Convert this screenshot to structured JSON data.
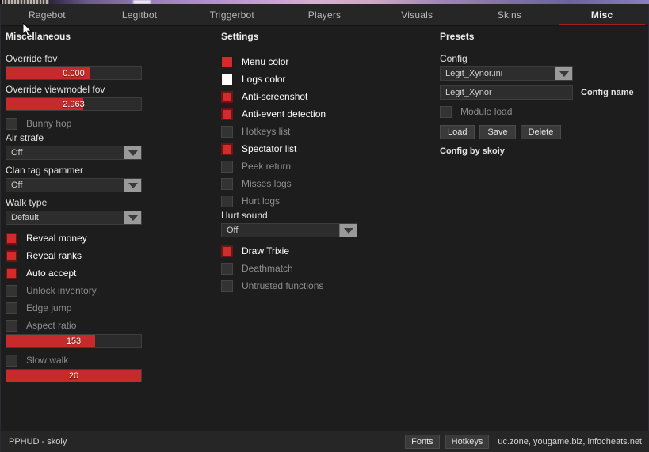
{
  "window": {
    "accent_color": "#c62a2a",
    "background_color": "#1d1d1d"
  },
  "tabs": [
    {
      "label": "Ragebot",
      "active": false
    },
    {
      "label": "Legitbot",
      "active": false
    },
    {
      "label": "Triggerbot",
      "active": false
    },
    {
      "label": "Players",
      "active": false
    },
    {
      "label": "Visuals",
      "active": false
    },
    {
      "label": "Skins",
      "active": false
    },
    {
      "label": "Misc",
      "active": true
    }
  ],
  "misc": {
    "title": "Miscellaneous",
    "override_fov": {
      "label": "Override fov",
      "value": "0.000",
      "fill_percent": 62
    },
    "override_viewmodel_fov": {
      "label": "Override viewmodel fov",
      "value": "2.963",
      "fill_percent": 57
    },
    "bunny_hop": {
      "label": "Bunny hop",
      "checked": false
    },
    "air_strafe": {
      "label": "Air strafe",
      "value": "Off"
    },
    "clan_tag_spammer": {
      "label": "Clan tag spammer",
      "value": "Off"
    },
    "walk_type": {
      "label": "Walk type",
      "value": "Default"
    },
    "checkboxes": [
      {
        "label": "Reveal money",
        "checked": true
      },
      {
        "label": "Reveal ranks",
        "checked": true
      },
      {
        "label": "Auto accept",
        "checked": true
      },
      {
        "label": "Unlock inventory",
        "checked": false
      },
      {
        "label": "Edge jump",
        "checked": false
      },
      {
        "label": "Aspect ratio",
        "checked": false
      }
    ],
    "aspect_ratio_slider": {
      "value": "153",
      "fill_percent": 66
    },
    "slow_walk": {
      "label": "Slow walk",
      "checked": false
    },
    "slow_walk_slider": {
      "value": "20",
      "fill_percent": 100
    }
  },
  "settings": {
    "title": "Settings",
    "colors": [
      {
        "label": "Menu color",
        "color": "#d12b2b"
      },
      {
        "label": "Logs color",
        "color": "#ffffff"
      }
    ],
    "checkboxes_top": [
      {
        "label": "Anti-screenshot",
        "checked": true
      },
      {
        "label": "Anti-event detection",
        "checked": true
      },
      {
        "label": "Hotkeys list",
        "checked": false
      },
      {
        "label": "Spectator list",
        "checked": true
      },
      {
        "label": "Peek return",
        "checked": false
      },
      {
        "label": "Misses logs",
        "checked": false
      },
      {
        "label": "Hurt logs",
        "checked": false
      }
    ],
    "hurt_sound": {
      "label": "Hurt sound",
      "value": "Off"
    },
    "checkboxes_bottom": [
      {
        "label": "Draw Trixie",
        "checked": true
      },
      {
        "label": "Deathmatch",
        "checked": false
      },
      {
        "label": "Untrusted functions",
        "checked": false
      }
    ]
  },
  "presets": {
    "title": "Presets",
    "config_label": "Config",
    "config_value": "Legit_Xynor.ini",
    "config_name_value": "Legit_Xynor",
    "config_name_placeholder": "Config name",
    "config_name_label": "Config name",
    "module_load": {
      "label": "Module load",
      "checked": false
    },
    "buttons": [
      {
        "label": "Load"
      },
      {
        "label": "Save"
      },
      {
        "label": "Delete"
      }
    ],
    "credit": "Config by skoiy"
  },
  "status_bar": {
    "brand": "PPHUD - skoiy",
    "fonts_button": "Fonts",
    "hotkeys_button": "Hotkeys",
    "sites": "uc.zone, yougame.biz, infocheats.net"
  }
}
